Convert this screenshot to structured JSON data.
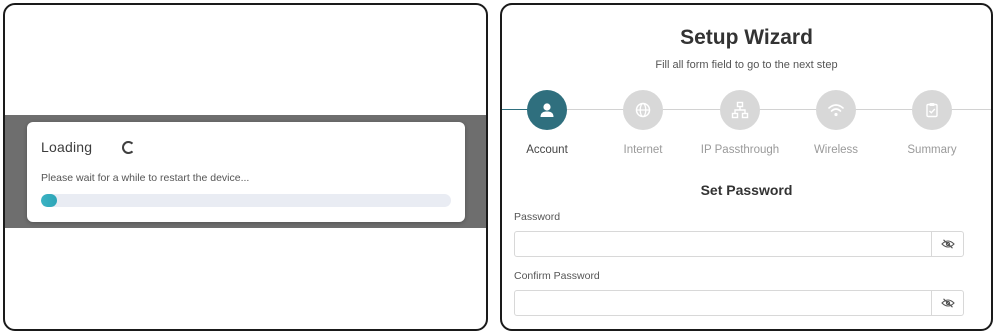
{
  "loading": {
    "title": "Loading",
    "message": "Please wait for a while to restart the device...",
    "progress_fraction": 0.04,
    "accent_color": "#3bb3c3"
  },
  "wizard": {
    "title": "Setup Wizard",
    "subtitle": "Fill all form field to go to the next step",
    "accent_color": "#2f6f7e",
    "steps": [
      {
        "label": "Account",
        "icon": "user-icon",
        "active": true
      },
      {
        "label": "Internet",
        "icon": "globe-icon",
        "active": false
      },
      {
        "label": "IP Passthrough",
        "icon": "network-icon",
        "active": false
      },
      {
        "label": "Wireless",
        "icon": "wifi-icon",
        "active": false
      },
      {
        "label": "Summary",
        "icon": "clipboard-check-icon",
        "active": false
      }
    ],
    "section_title": "Set Password",
    "fields": {
      "password": {
        "label": "Password",
        "value": "",
        "icon": "eye-off-icon"
      },
      "confirm_password": {
        "label": "Confirm Password",
        "value": "",
        "icon": "eye-off-icon"
      }
    }
  }
}
